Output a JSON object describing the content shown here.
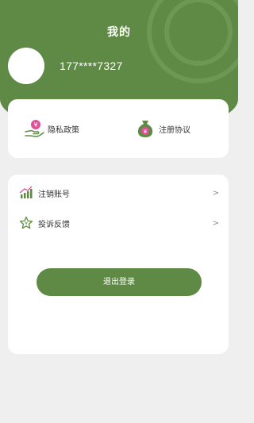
{
  "header": {
    "title": "我的",
    "phone": "177****7327"
  },
  "agreements": {
    "privacy": {
      "label": "隐私政策",
      "icon": "money-hand-icon"
    },
    "register": {
      "label": "注册协议",
      "icon": "money-bag-icon"
    }
  },
  "menu": [
    {
      "label": "注销账号",
      "icon": "chart-bars-icon",
      "chevron": ">"
    },
    {
      "label": "投诉反馈",
      "icon": "star-icon",
      "chevron": ">"
    }
  ],
  "logout": {
    "label": "退出登录"
  },
  "colors": {
    "brand": "#5f8a45",
    "background": "#efefef",
    "card": "#ffffff",
    "accent_pink": "#e0509a",
    "text": "#333333"
  }
}
